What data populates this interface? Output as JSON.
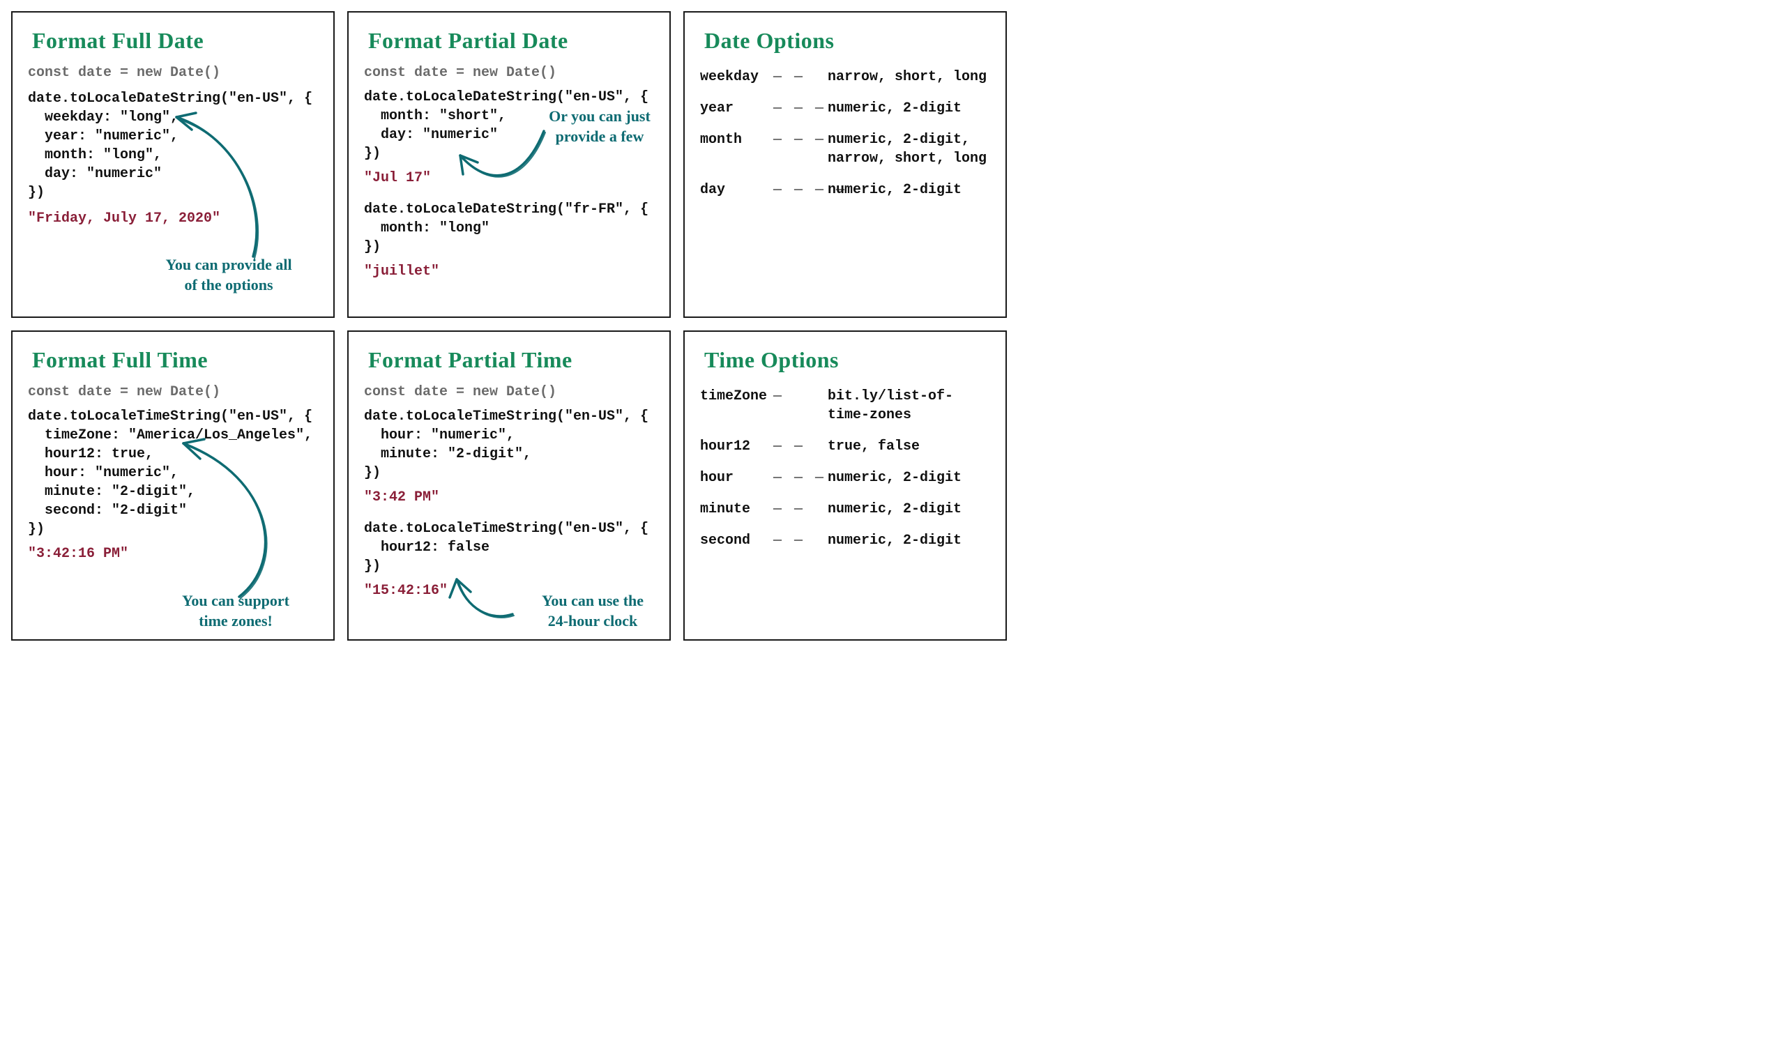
{
  "cards": {
    "fullDate": {
      "title": "Format Full Date",
      "decl": "const date = new Date()",
      "code": "date.toLocaleDateString(\"en-US\", {\n  weekday: \"long\",\n  year: \"numeric\",\n  month: \"long\",\n  day: \"numeric\"\n})",
      "output": "\"Friday, July 17, 2020\"",
      "annotation": "You can provide all\nof the options"
    },
    "partialDate": {
      "title": "Format Partial Date",
      "decl": "const date = new Date()",
      "code1": "date.toLocaleDateString(\"en-US\", {\n  month: \"short\",\n  day: \"numeric\"\n})",
      "output1": "\"Jul 17\"",
      "code2": "date.toLocaleDateString(\"fr-FR\", {\n  month: \"long\"\n})",
      "output2": "\"juillet\"",
      "annotation": "Or you can just\nprovide a few"
    },
    "dateOptions": {
      "title": "Date Options",
      "rows": [
        {
          "key": "weekday",
          "dashes": "— —",
          "vals": "narrow, short, long"
        },
        {
          "key": "year",
          "dashes": "— — —",
          "vals": "numeric, 2-digit"
        },
        {
          "key": "month",
          "dashes": "— — —",
          "vals": "numeric, 2-digit,\nnarrow, short, long"
        },
        {
          "key": "day",
          "dashes": "— — — —",
          "vals": "numeric, 2-digit"
        }
      ]
    },
    "fullTime": {
      "title": "Format Full Time",
      "decl": "const date = new Date()",
      "code": "date.toLocaleTimeString(\"en-US\", {\n  timeZone: \"America/Los_Angeles\",\n  hour12: true,\n  hour: \"numeric\",\n  minute: \"2-digit\",\n  second: \"2-digit\"\n})",
      "output": "\"3:42:16 PM\"",
      "annotation": "You can support\ntime zones!"
    },
    "partialTime": {
      "title": "Format Partial Time",
      "decl": "const date = new Date()",
      "code1": "date.toLocaleTimeString(\"en-US\", {\n  hour: \"numeric\",\n  minute: \"2-digit\",\n})",
      "output1": "\"3:42 PM\"",
      "code2": "date.toLocaleTimeString(\"en-US\", {\n  hour12: false\n})",
      "output2": "\"15:42:16\"",
      "annotation": "You can use the\n24-hour clock"
    },
    "timeOptions": {
      "title": "Time Options",
      "rows": [
        {
          "key": "timeZone",
          "dashes": "—",
          "vals": "bit.ly/list-of-time-zones"
        },
        {
          "key": "hour12",
          "dashes": "— —",
          "vals": "true, false"
        },
        {
          "key": "hour",
          "dashes": "— — —",
          "vals": "numeric, 2-digit"
        },
        {
          "key": "minute",
          "dashes": "— —",
          "vals": "numeric, 2-digit"
        },
        {
          "key": "second",
          "dashes": "— —",
          "vals": "numeric, 2-digit"
        }
      ]
    }
  }
}
